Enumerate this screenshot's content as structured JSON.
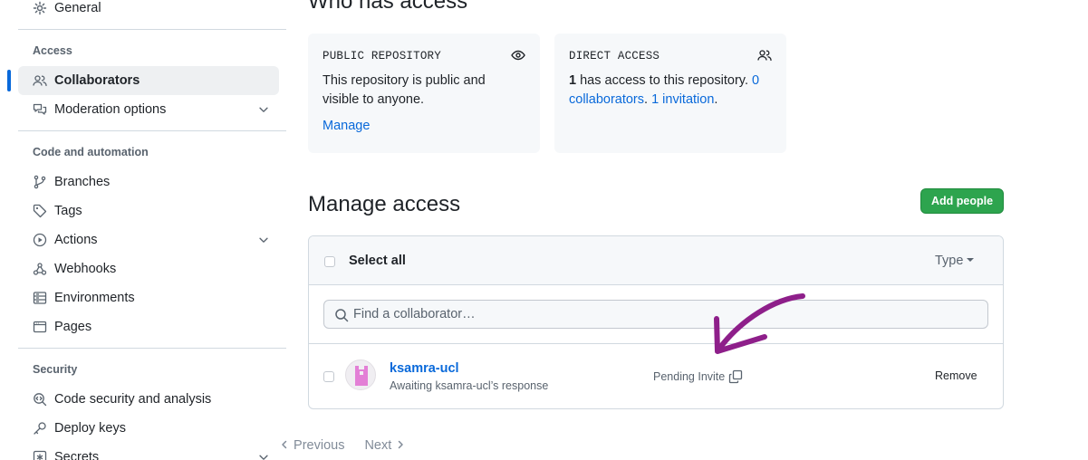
{
  "sidebar": {
    "top_item": {
      "label": "General",
      "icon": "gear-icon"
    },
    "groups": [
      {
        "heading": "Access"
      },
      {
        "heading": "Code and automation"
      },
      {
        "heading": "Security"
      }
    ],
    "items": {
      "collaborators": {
        "label": "Collaborators",
        "icon": "people-icon"
      },
      "moderation": {
        "label": "Moderation options",
        "icon": "comment-discussion-icon"
      },
      "branches": {
        "label": "Branches",
        "icon": "git-branch-icon"
      },
      "tags": {
        "label": "Tags",
        "icon": "tag-icon"
      },
      "actions": {
        "label": "Actions",
        "icon": "play-icon"
      },
      "webhooks": {
        "label": "Webhooks",
        "icon": "webhook-icon"
      },
      "environments": {
        "label": "Environments",
        "icon": "server-icon"
      },
      "pages": {
        "label": "Pages",
        "icon": "browser-icon"
      },
      "code_security": {
        "label": "Code security and analysis",
        "icon": "codescan-icon"
      },
      "deploy_keys": {
        "label": "Deploy keys",
        "icon": "key-icon"
      },
      "secrets": {
        "label": "Secrets",
        "icon": "key-asterisk-icon"
      }
    },
    "active": "Collaborators"
  },
  "who_has_access": {
    "heading": "Who has access",
    "public_card": {
      "title": "PUBLIC REPOSITORY",
      "text": "This repository is public and visible to anyone.",
      "link": "Manage"
    },
    "direct_card": {
      "title": "DIRECT ACCESS",
      "count": "1",
      "text_a": " has access to this repository. ",
      "collaborators_link": "0 collaborators",
      "sep": ". ",
      "invitation_link": "1 invitation",
      "end": "."
    }
  },
  "manage_access": {
    "heading": "Manage access",
    "add_button": "Add people",
    "select_all": "Select all",
    "type_filter": "Type",
    "search_placeholder": "Find a collaborator…",
    "rows": [
      {
        "username": "ksamra-ucl",
        "subtitle": "Awaiting ksamra-ucl’s response",
        "status": "Pending Invite",
        "action": "Remove"
      }
    ]
  },
  "pagination": {
    "previous": "Previous",
    "next": "Next"
  },
  "colors": {
    "accent": "#0969da",
    "primary_button": "#2da44e",
    "annotation_arrow": "#8e1f8a"
  }
}
